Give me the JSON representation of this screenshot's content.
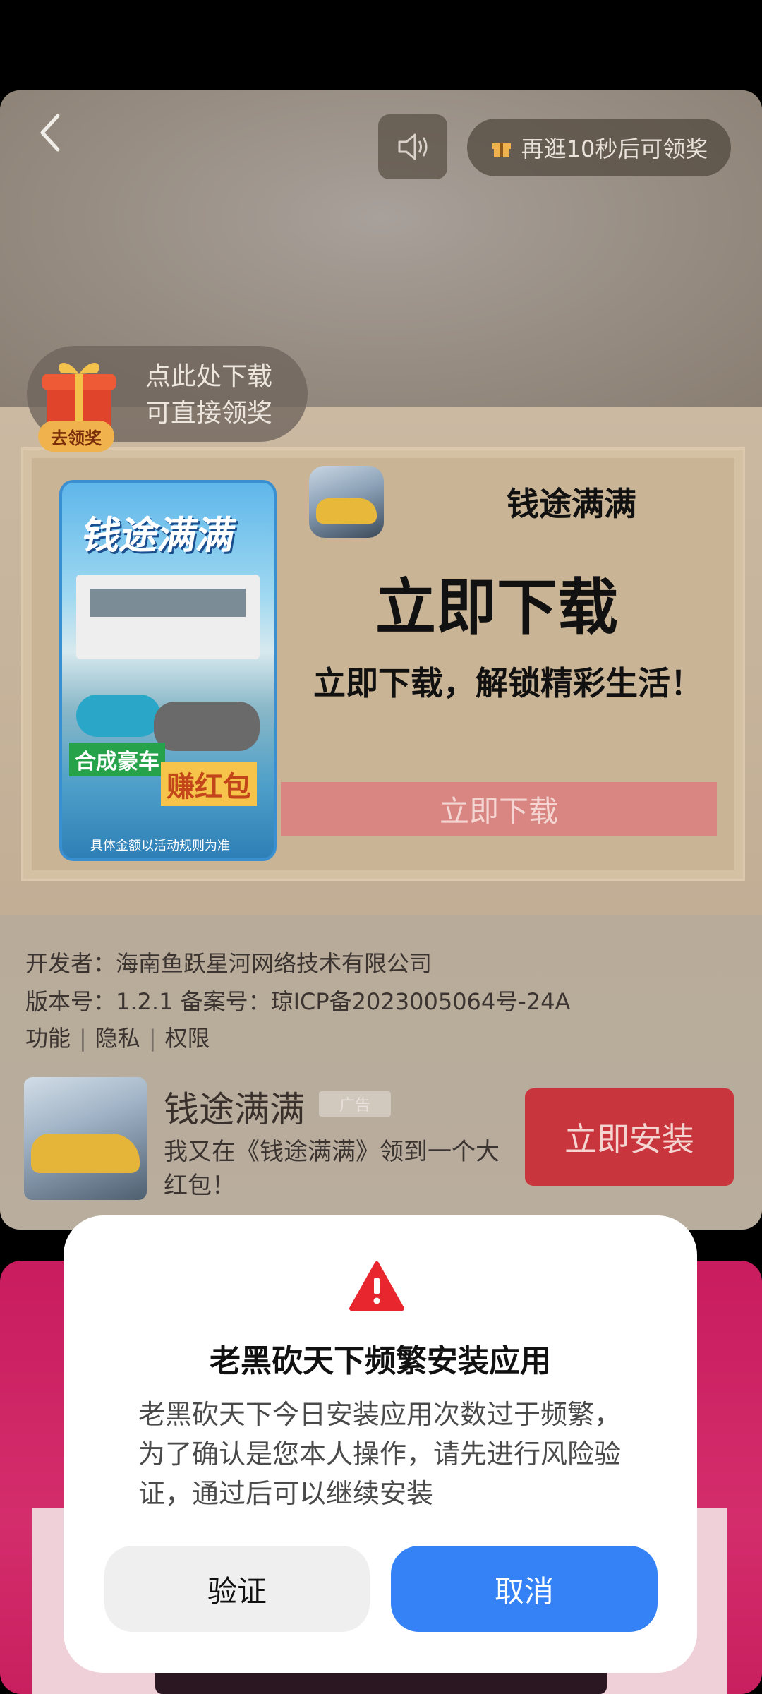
{
  "top_bar": {
    "reward_timer": "再逛10秒后可领奖"
  },
  "download_bubble": {
    "line1": "点此处下载",
    "line2": "可直接领奖",
    "gift_tag": "去领奖"
  },
  "banner": {
    "poster_title": "钱途满满",
    "poster_tag1": "合成豪车",
    "poster_tag2": "赚红包",
    "poster_note": "具体金额以活动规则为准",
    "app_name": "钱途满满",
    "headline": "立即下载",
    "subtitle": "立即下载，解锁精彩生活！",
    "button_label": "立即下载"
  },
  "app_info": {
    "developer": "开发者：海南鱼跃星河网络技术有限公司",
    "version_line": "版本号：1.2.1    备案号：琼ICP备2023005064号-24A",
    "links": [
      "功能",
      "隐私",
      "权限"
    ]
  },
  "promo": {
    "name": "钱途满满",
    "ad_badge": "广告",
    "description": "我又在《钱途满满》领到一个大红包！",
    "install_label": "立即安装"
  },
  "dialog": {
    "title": "老黑砍天下频繁安装应用",
    "body": "老黑砍天下今日安装应用次数过于频繁，为了确认是您本人操作，请先进行风险验证，通过后可以继续安装",
    "verify_label": "验证",
    "cancel_label": "取消"
  },
  "colors": {
    "install_red": "#c9353c",
    "cancel_blue": "#3482f6",
    "warning_red": "#e8262d"
  }
}
